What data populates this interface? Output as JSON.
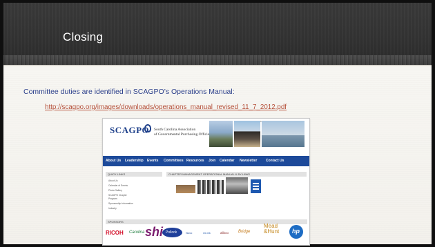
{
  "slide": {
    "title": "Closing",
    "body": "Committee duties are identified in SCAGPO’s Operations Manual:",
    "link": "http://scagpo.org/images/downloads/operations_manual_revised_11_7_2012.pdf"
  },
  "website_screenshot": {
    "logo": "SCAGPO",
    "org_line1": "South Carolina Association",
    "org_line2": "of Governmental Purchasing Officials",
    "top_links": "Home Page   Member Area   Contact Us",
    "nav": [
      "About Us",
      "Leadership",
      "Events",
      "Committees",
      "Resources",
      "Join",
      "Calendar",
      "Newsletter",
      "Contact Us"
    ],
    "sidebar_heading": "QUICK LINKS",
    "sidebar_items": [
      "About Us",
      "Calendar of Events",
      "Photo Gallery",
      "SCAGPO Chapter",
      "Program",
      "Sponsorship Information",
      "Industry"
    ],
    "main_heading": "CHAPTER MANAGEMENT OPERATIONAL MANUAL & BY-LAWS",
    "sponsors_heading": "SPONSORS",
    "sponsors": {
      "ricoh": "RICOH",
      "carolina": "Carolina",
      "shi": "shi",
      "pollock": "Pollock",
      "small1": "Novo",
      "small2": "mi-tek",
      "small3": "aliboo",
      "bridge": "Bridge",
      "mead_line1": "Mead",
      "mead_line2": "&Hunt",
      "hp": "hp"
    }
  }
}
